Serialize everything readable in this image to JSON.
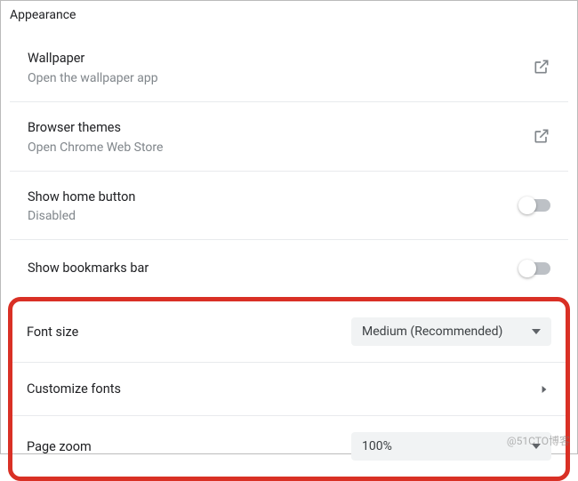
{
  "section_title": "Appearance",
  "rows": {
    "wallpaper": {
      "title": "Wallpaper",
      "sub": "Open the wallpaper app"
    },
    "themes": {
      "title": "Browser themes",
      "sub": "Open Chrome Web Store"
    },
    "home": {
      "title": "Show home button",
      "sub": "Disabled"
    },
    "bookmarks": {
      "title": "Show bookmarks bar"
    }
  },
  "highlight": {
    "font_size": {
      "label": "Font size",
      "value": "Medium (Recommended)"
    },
    "customize_fonts": {
      "label": "Customize fonts"
    },
    "page_zoom": {
      "label": "Page zoom",
      "value": "100%"
    }
  },
  "watermark": "@51CTO博客"
}
